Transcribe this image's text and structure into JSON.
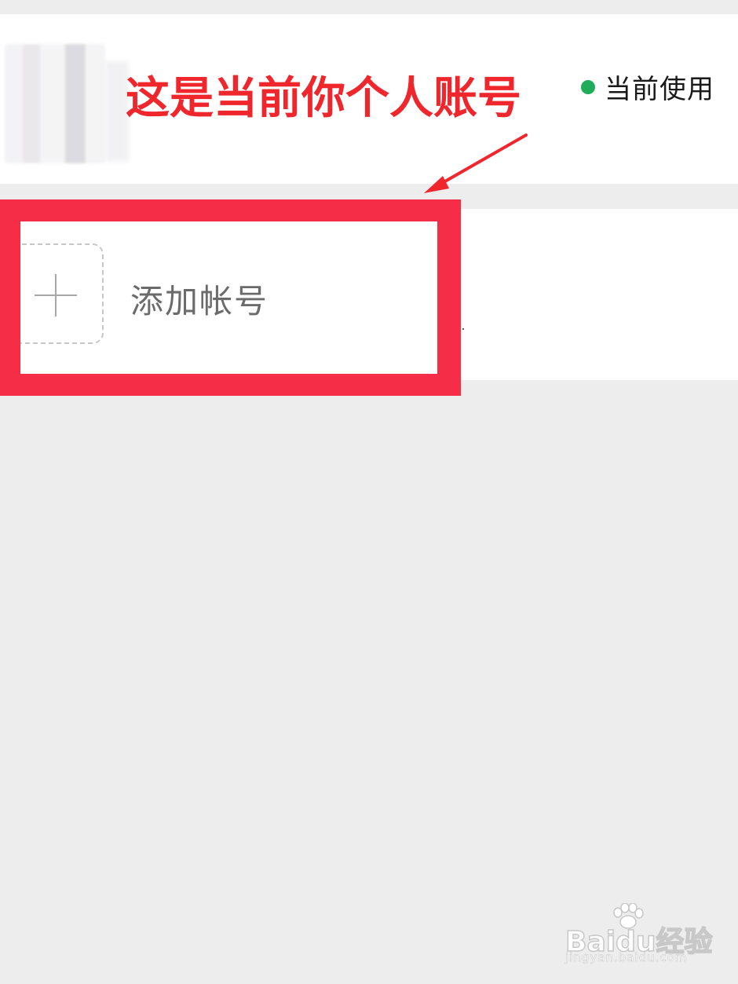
{
  "current_account": {
    "status_label": "当前使用",
    "status_color": "#1fad5b"
  },
  "annotation": {
    "text": "这是当前你个人账号",
    "color": "#f0262d"
  },
  "add_account": {
    "label": "添加帐号",
    "icon": "plus-icon",
    "highlight_color": "#f52d47"
  },
  "watermark": {
    "logo": "Baidu经验",
    "url": "jingyan.baidu.com"
  }
}
